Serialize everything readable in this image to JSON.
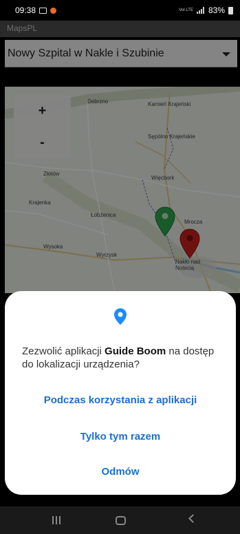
{
  "status_bar": {
    "time": "09:38",
    "network": "Vol LTE",
    "battery": "83%"
  },
  "app_bar": {
    "title": "MapsPL"
  },
  "dropdown": {
    "selected": "Nowy Szpital w Nakle i Szubinie"
  },
  "map": {
    "labels": [
      "Debrzno",
      "Kamień Krajeński",
      "Sępólno Krajeńskie",
      "Złotów",
      "Więcbork",
      "Krajenka",
      "Łobżenica",
      "Mrocza",
      "Wysoka",
      "Wyrzysk",
      "Nakło nad Notecią"
    ],
    "zoom_in": "+",
    "zoom_out": "-"
  },
  "dialog": {
    "prompt_before": "Zezwolić aplikacji ",
    "app_name": "Guide Boom",
    "prompt_after": " na dostęp do lokalizacji urządzenia?",
    "options": [
      "Podczas korzystania z aplikacji",
      "Tylko tym razem",
      "Odmów"
    ]
  },
  "colors": {
    "accent": "#1a6fd0",
    "pin_green": "#2ea44f",
    "pin_red": "#c8221e"
  }
}
